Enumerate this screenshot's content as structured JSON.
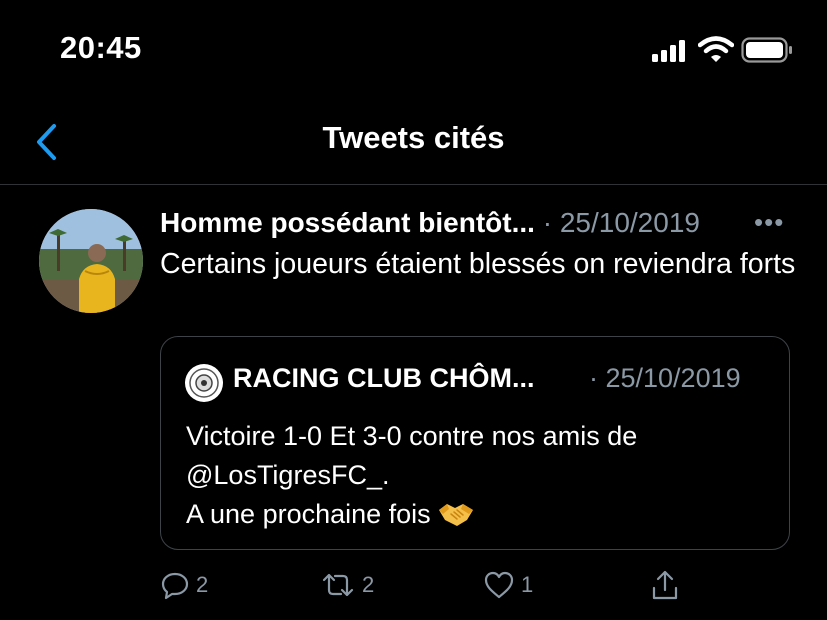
{
  "status_bar": {
    "time": "20:45"
  },
  "nav": {
    "title": "Tweets cités"
  },
  "tweet": {
    "author": "Homme possédant bientôt...",
    "date": "· 25/10/2019",
    "more": "•••",
    "text": "Certains joueurs étaient blessés on reviendra forts",
    "quote": {
      "author": "RACING CLUB CHÔM...",
      "date": "· 25/10/2019",
      "lines": [
        "Victoire 1-0 Et 3-0 contre nos amis de",
        "@LosTigresFC_.",
        "A une prochaine fois"
      ]
    },
    "actions": {
      "replies": "2",
      "retweets": "2",
      "likes": "1"
    }
  },
  "colors": {
    "background": "#000000",
    "text": "#ffffff",
    "secondary": "#8b98a5",
    "accent": "#1d9bf0",
    "border": "#3d4348"
  },
  "icons": [
    "back-chevron-icon",
    "signal-icon",
    "wifi-icon",
    "battery-icon",
    "more-icon",
    "reply-icon",
    "retweet-icon",
    "like-icon",
    "share-icon",
    "handshake-emoji"
  ]
}
